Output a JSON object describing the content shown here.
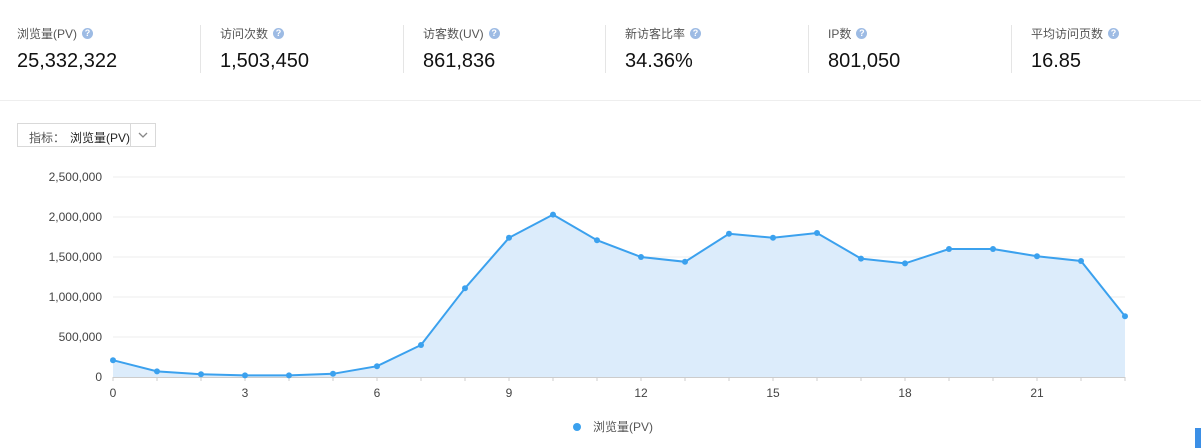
{
  "stats": [
    {
      "label": "浏览量(PV)",
      "value": "25,332,322"
    },
    {
      "label": "访问次数",
      "value": "1,503,450"
    },
    {
      "label": "访客数(UV)",
      "value": "861,836"
    },
    {
      "label": "新访客比率",
      "value": "34.36%"
    },
    {
      "label": "IP数",
      "value": "801,050"
    },
    {
      "label": "平均访问页数",
      "value": "16.85"
    }
  ],
  "help_icon_glyph": "?",
  "selector": {
    "label": "指标：",
    "value": "浏览量(PV)",
    "icon": "chevron-down-icon"
  },
  "colors": {
    "series": "#3ba1ee",
    "area": "#dcecfb",
    "grid": "#eeeeee",
    "axis_text": "#444444"
  },
  "chart_data": {
    "type": "area",
    "x": [
      0,
      1,
      2,
      3,
      4,
      5,
      6,
      7,
      8,
      9,
      10,
      11,
      12,
      13,
      14,
      15,
      16,
      17,
      18,
      19,
      20,
      21,
      22,
      23
    ],
    "x_tick_labels": [
      "0",
      "3",
      "6",
      "9",
      "12",
      "15",
      "18",
      "21"
    ],
    "x_ticks": [
      0,
      3,
      6,
      9,
      12,
      15,
      18,
      21
    ],
    "y_tick_labels": [
      "0",
      "500,000",
      "1,000,000",
      "1,500,000",
      "2,000,000",
      "2,500,000"
    ],
    "y_ticks": [
      0,
      500000,
      1000000,
      1500000,
      2000000,
      2500000
    ],
    "ylim": [
      0,
      2500000
    ],
    "xlim": [
      0,
      23
    ],
    "grid": true,
    "legend_position": "bottom-center",
    "series": [
      {
        "name": "浏览量(PV)",
        "values": [
          210000,
          70000,
          35000,
          20000,
          20000,
          40000,
          135000,
          400000,
          1110000,
          1740000,
          2030000,
          1710000,
          1500000,
          1440000,
          1790000,
          1740000,
          1800000,
          1480000,
          1420000,
          1600000,
          1600000,
          1510000,
          1450000,
          760000
        ]
      }
    ]
  }
}
